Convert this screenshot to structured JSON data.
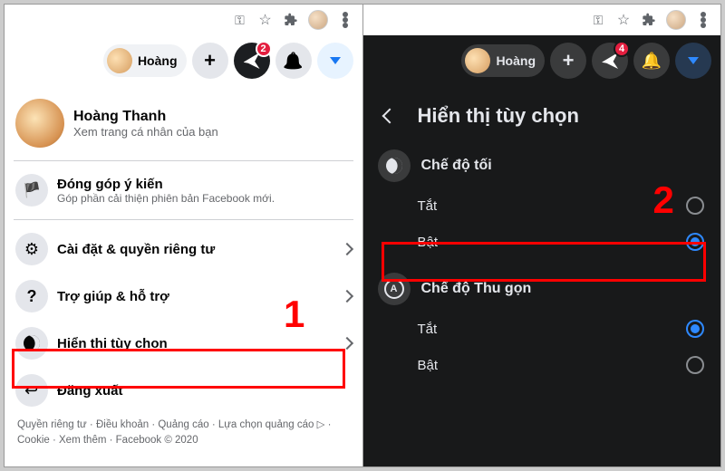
{
  "left": {
    "browser": {
      "key_icon": "key-icon",
      "star_icon": "star-icon",
      "ext_icon": "extensions-icon",
      "avatar": "browser-profile-avatar",
      "menu_icon": "kebab-menu-icon"
    },
    "header": {
      "short_name": "Hoàng",
      "messenger_badge": "2"
    },
    "profile": {
      "name": "Hoàng Thanh",
      "sub": "Xem trang cá nhân của bạn"
    },
    "feedback": {
      "title": "Đóng góp ý kiến",
      "sub": "Góp phần cải thiện phiên bản Facebook mới."
    },
    "rows": {
      "settings": "Cài đặt & quyền riêng tư",
      "help": "Trợ giúp & hỗ trợ",
      "display": "Hiển thị tùy chọn",
      "logout": "Đăng xuất"
    },
    "footer": "Quyền riêng tư · Điều khoản · Quảng cáo · Lựa chọn quảng cáo ▷ · Cookie · Xem thêm · Facebook © 2020",
    "annotation_num": "1"
  },
  "right": {
    "header": {
      "short_name": "Hoàng",
      "messenger_badge": "4"
    },
    "title": "Hiển thị tùy chọn",
    "dark_mode_label": "Chế độ tối",
    "compact_label": "Chế độ Thu gọn",
    "opt_off": "Tắt",
    "opt_on": "Bật",
    "annotation_num": "2"
  }
}
